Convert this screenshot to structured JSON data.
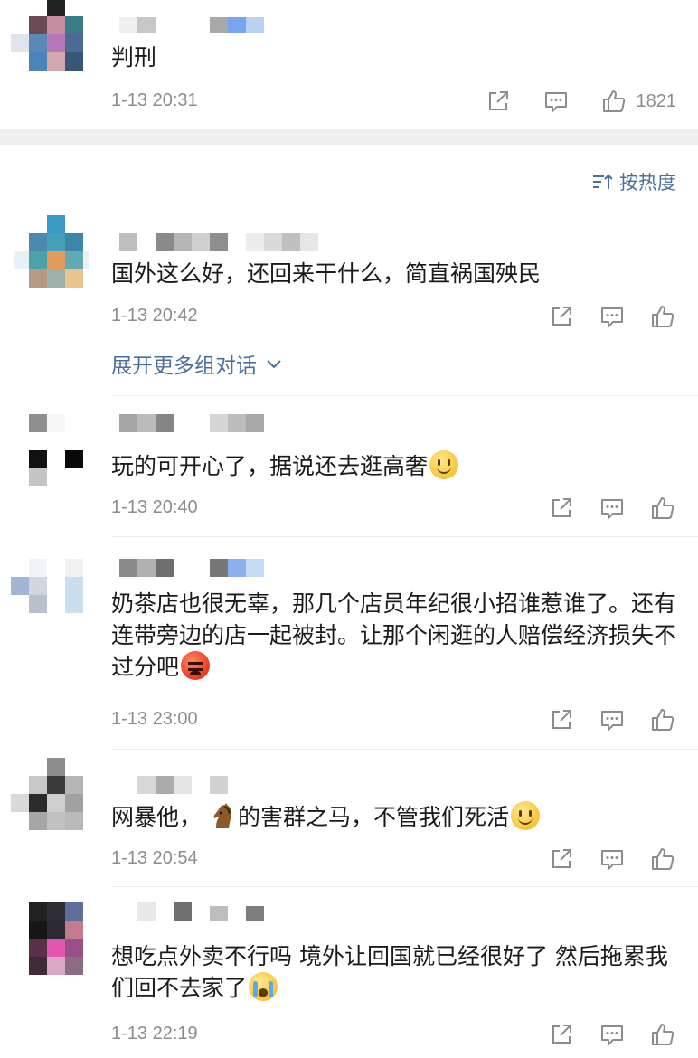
{
  "top_comment": {
    "text": "判刑",
    "time": "1-13 20:31",
    "like_count": "1821"
  },
  "sort": {
    "label": "按热度"
  },
  "comments": [
    {
      "text": "国外这么好，还回来干什么，简直祸国殃民",
      "time": "1-13 20:42",
      "expand": "展开更多组对话"
    },
    {
      "text": "玩的可开心了，据说还去逛高奢",
      "time": "1-13 20:40"
    },
    {
      "text": "奶茶店也很无辜，那几个店员年纪很小招谁惹谁了。还有连带旁边的店一起被封。让那个闲逛的人赔偿经济损失不过分吧",
      "time": "1-13 23:00"
    },
    {
      "text_a": "网暴他，",
      "text_b": "的害群之马，不管我们死活",
      "time": "1-13 20:54"
    },
    {
      "text": "想吃点外卖不行吗 境外让回国就已经很好了 然后拖累我们回不去家了",
      "time": "1-13 22:19"
    }
  ],
  "icons": {
    "share": "share-icon",
    "comment": "comment-icon",
    "like": "thumbs-up-icon",
    "sort": "sort-icon",
    "chevron": "chevron-down-icon"
  },
  "colors": {
    "link": "#4a6f9c",
    "meta": "#8c8c8c",
    "separator": "#efefef"
  }
}
